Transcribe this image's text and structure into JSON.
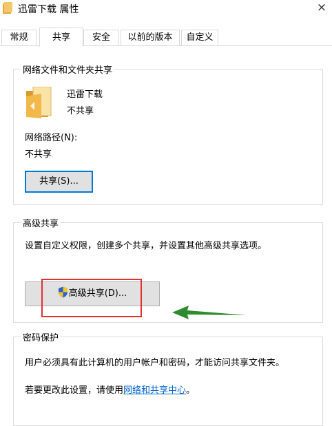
{
  "window": {
    "title": "迅雷下载 属性",
    "close": "×"
  },
  "tabs": [
    {
      "label": "常规",
      "active": false
    },
    {
      "label": "共享",
      "active": true
    },
    {
      "label": "安全",
      "active": false
    },
    {
      "label": "以前的版本",
      "active": false
    },
    {
      "label": "自定义",
      "active": false
    }
  ],
  "network_sharing": {
    "legend": "网络文件和文件夹共享",
    "folder_name": "迅雷下载",
    "folder_status": "不共享",
    "network_path_label": "网络路径(N):",
    "network_path_value": "不共享",
    "share_button": "共享(S)..."
  },
  "advanced_sharing": {
    "legend": "高级共享",
    "description": "设置自定义权限，创建多个共享，并设置其他高级共享选项。",
    "button": "高级共享(D)..."
  },
  "password_protection": {
    "legend": "密码保护",
    "text1": "用户必须具有此计算机的用户帐户和密码，才能访问共享文件夹。",
    "text2_prefix": "若要更改此设置，请使用",
    "link": "网络和共享中心",
    "text2_suffix": "。"
  },
  "annotations": {
    "highlight_color": "#e03030",
    "arrow_color": "#2e8b2e"
  },
  "icons": {
    "folder": "folder-icon",
    "shield": "uac-shield-icon",
    "title": "folder-icon"
  }
}
